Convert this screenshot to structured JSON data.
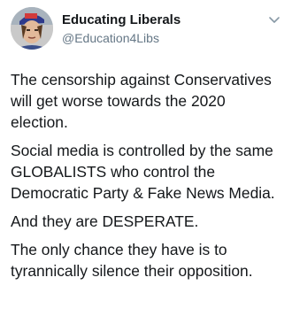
{
  "tweet": {
    "author": {
      "display_name": "Educating Liberals",
      "handle": "@Education4Libs",
      "avatar_icon": "avatar-photo"
    },
    "menu_icon": "chevron-down-icon",
    "paragraphs": [
      {
        "lines": [
          "The censorship against Conservatives",
          "will get worse towards the 2020",
          "election."
        ]
      },
      {
        "lines": [
          "Social media is controlled by the same",
          "GLOBALISTS who control the",
          "Democratic Party & Fake News Media."
        ]
      },
      {
        "lines": [
          "And they are DESPERATE."
        ]
      },
      {
        "lines": [
          "The only chance they have is to",
          "tyrannically silence their opposition."
        ]
      }
    ],
    "colors": {
      "text": "#14171a",
      "handle": "#657786",
      "background": "#ffffff"
    }
  }
}
